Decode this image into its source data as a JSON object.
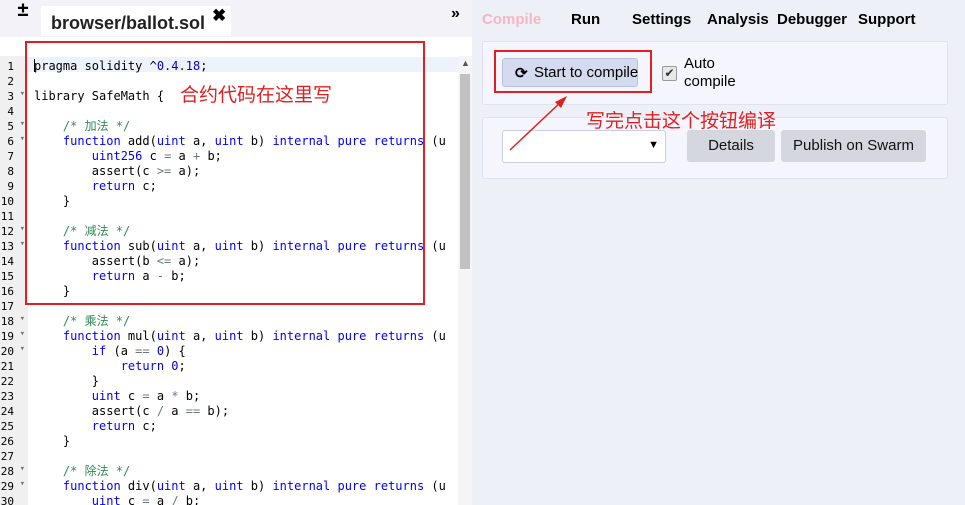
{
  "editor": {
    "file_tab": "browser/ballot.sol",
    "close_glyph": "✖",
    "new_file_glyph": "±",
    "more_tabs_glyph": "»",
    "lines": [
      {
        "n": "1",
        "fold": "",
        "text": "pragma solidity ^0.4.18;"
      },
      {
        "n": "2",
        "fold": "",
        "text": ""
      },
      {
        "n": "3",
        "fold": "▾",
        "text": "library SafeMath {"
      },
      {
        "n": "4",
        "fold": "",
        "text": ""
      },
      {
        "n": "5",
        "fold": "▾",
        "text": "    /* 加法 */"
      },
      {
        "n": "6",
        "fold": "▾",
        "text": "    function add(uint a, uint b) internal pure returns (u"
      },
      {
        "n": "7",
        "fold": "",
        "text": "        uint256 c = a + b;"
      },
      {
        "n": "8",
        "fold": "",
        "text": "        assert(c >= a);"
      },
      {
        "n": "9",
        "fold": "",
        "text": "        return c;"
      },
      {
        "n": "10",
        "fold": "",
        "text": "    }"
      },
      {
        "n": "11",
        "fold": "",
        "text": ""
      },
      {
        "n": "12",
        "fold": "▾",
        "text": "    /* 减法 */"
      },
      {
        "n": "13",
        "fold": "▾",
        "text": "    function sub(uint a, uint b) internal pure returns (u"
      },
      {
        "n": "14",
        "fold": "",
        "text": "        assert(b <= a);"
      },
      {
        "n": "15",
        "fold": "",
        "text": "        return a - b;"
      },
      {
        "n": "16",
        "fold": "",
        "text": "    }"
      },
      {
        "n": "17",
        "fold": "",
        "text": ""
      },
      {
        "n": "18",
        "fold": "▾",
        "text": "    /* 乘法 */"
      },
      {
        "n": "19",
        "fold": "▾",
        "text": "    function mul(uint a, uint b) internal pure returns (u"
      },
      {
        "n": "20",
        "fold": "▾",
        "text": "        if (a == 0) {"
      },
      {
        "n": "21",
        "fold": "",
        "text": "            return 0;"
      },
      {
        "n": "22",
        "fold": "",
        "text": "        }"
      },
      {
        "n": "23",
        "fold": "",
        "text": "        uint c = a * b;"
      },
      {
        "n": "24",
        "fold": "",
        "text": "        assert(c / a == b);"
      },
      {
        "n": "25",
        "fold": "",
        "text": "        return c;"
      },
      {
        "n": "26",
        "fold": "",
        "text": "    }"
      },
      {
        "n": "27",
        "fold": "",
        "text": ""
      },
      {
        "n": "28",
        "fold": "▾",
        "text": "    /* 除法 */"
      },
      {
        "n": "29",
        "fold": "▾",
        "text": "    function div(uint a, uint b) internal pure returns (u"
      },
      {
        "n": "30",
        "fold": "",
        "text": "        uint c = a / b;"
      }
    ]
  },
  "annotations": {
    "code_note": "合约代码在这里写",
    "button_note": "写完点击这个按钮编译"
  },
  "tabs": [
    {
      "label": "Compile",
      "active": true
    },
    {
      "label": "Run",
      "active": false
    },
    {
      "label": "Settings",
      "active": false
    },
    {
      "label": "Analysis",
      "active": false
    },
    {
      "label": "Debugger",
      "active": false
    },
    {
      "label": "Support",
      "active": false
    }
  ],
  "compile": {
    "button_label": "Start to compile",
    "button_icon": "refresh-icon",
    "auto_compile_label": "Auto compile",
    "auto_compile_checked": true
  },
  "contract": {
    "selected": "",
    "details_label": "Details",
    "publish_label": "Publish on Swarm"
  },
  "colors": {
    "annotation": "#e02020",
    "active_tab": "#f4b6c2",
    "keyword": "#0000ff",
    "comment": "#2e8b57"
  }
}
